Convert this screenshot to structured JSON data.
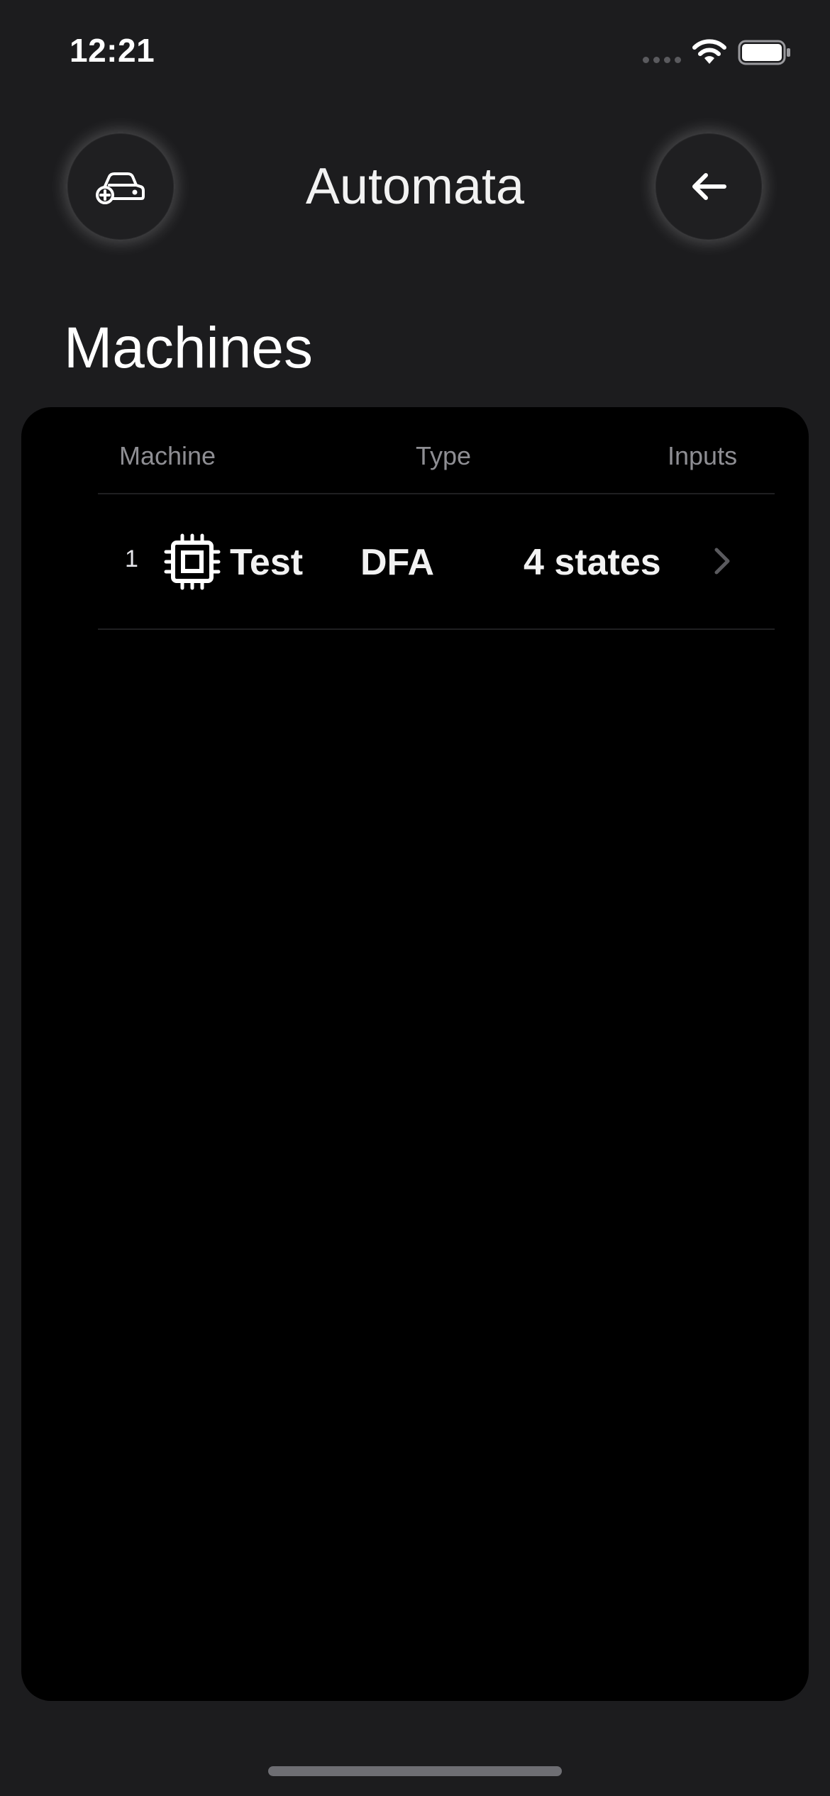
{
  "status_bar": {
    "time": "12:21",
    "icons": [
      "signal-dots-icon",
      "wifi-icon",
      "battery-icon"
    ]
  },
  "header": {
    "title": "Automata",
    "left_button_icon": "car-plus-icon",
    "right_button_icon": "arrow-left-icon"
  },
  "section": {
    "title": "Machines"
  },
  "table": {
    "columns": [
      "Machine",
      "Type",
      "Inputs"
    ],
    "rows": [
      {
        "index": "1",
        "icon": "cpu-chip-icon",
        "name": "Test",
        "type": "DFA",
        "inputs": "4 states"
      }
    ]
  },
  "colors": {
    "background": "#1c1c1e",
    "card": "#000000",
    "header_text": "#8e8e93",
    "divider": "#1f1f21"
  }
}
